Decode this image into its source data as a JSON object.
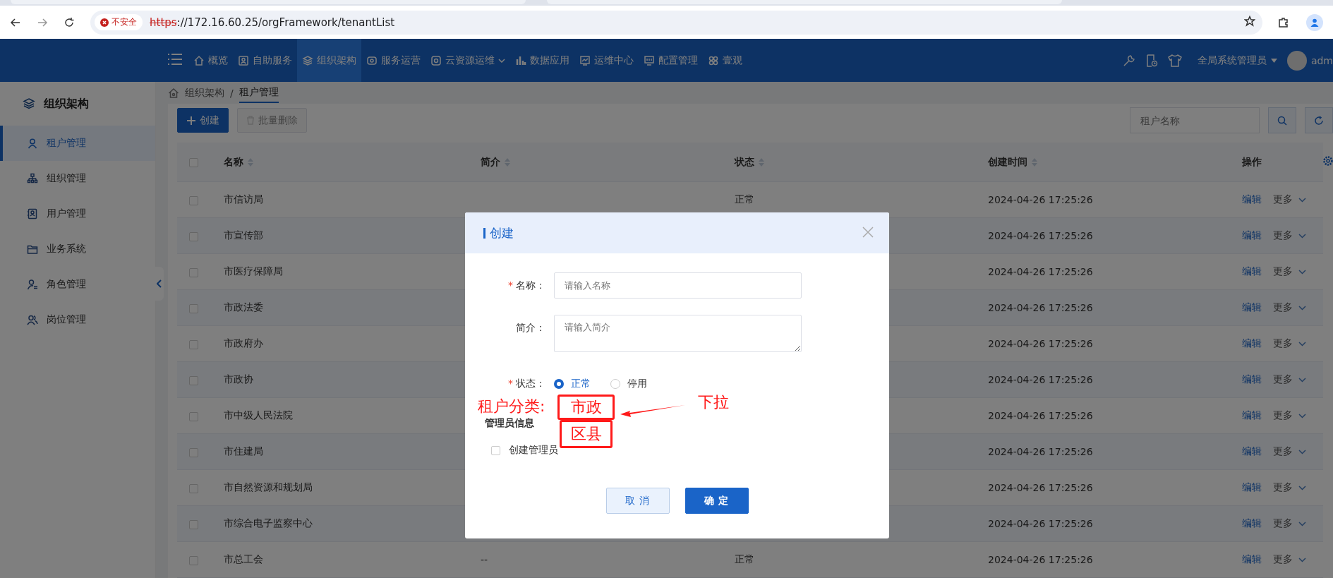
{
  "browser": {
    "security_label": "不安全",
    "url_scheme": "https",
    "url_rest": "://172.16.60.25/orgFramework/tenantList"
  },
  "nav": {
    "items": [
      {
        "label": "概览",
        "selected": false,
        "has_caret": false
      },
      {
        "label": "自助服务",
        "selected": false,
        "has_caret": false
      },
      {
        "label": "组织架构",
        "selected": true,
        "has_caret": false
      },
      {
        "label": "服务运营",
        "selected": false,
        "has_caret": false
      },
      {
        "label": "云资源运维",
        "selected": false,
        "has_caret": true
      },
      {
        "label": "数据应用",
        "selected": false,
        "has_caret": false
      },
      {
        "label": "运维中心",
        "selected": false,
        "has_caret": false
      },
      {
        "label": "配置管理",
        "selected": false,
        "has_caret": false
      },
      {
        "label": "壹观",
        "selected": false,
        "has_caret": false
      }
    ],
    "user": "全局系统管理员",
    "user_cut": "adm"
  },
  "sidebar": {
    "title": "组织架构",
    "items": [
      {
        "label": "租户管理",
        "selected": true
      },
      {
        "label": "组织管理",
        "selected": false
      },
      {
        "label": "用户管理",
        "selected": false
      },
      {
        "label": "业务系统",
        "selected": false
      },
      {
        "label": "角色管理",
        "selected": false
      },
      {
        "label": "岗位管理",
        "selected": false
      }
    ]
  },
  "breadcrumb": {
    "separator": "/",
    "items": [
      {
        "label": "组织架构",
        "current": false
      },
      {
        "label": "租户管理",
        "current": true
      }
    ]
  },
  "toolbar": {
    "create": "创建",
    "batch_delete": {
      "label": "批量删除",
      "disabled": true
    },
    "search_placeholder": "租户名称"
  },
  "table": {
    "header_checked": false,
    "columns": [
      {
        "label": "名称",
        "sortable": true
      },
      {
        "label": "简介",
        "sortable": true
      },
      {
        "label": "状态",
        "sortable": true
      },
      {
        "label": "创建时间",
        "sortable": true
      },
      {
        "label": "操作",
        "sortable": false
      }
    ],
    "rows": [
      {
        "checked": false,
        "name": "市信访局",
        "status": "正常",
        "created": "2024-04-26 17:25:26",
        "edit": "编辑",
        "more": "更多"
      },
      {
        "checked": false,
        "name": "市宣传部",
        "created": "2024-04-26 17:25:26",
        "edit": "编辑",
        "more": "更多"
      },
      {
        "checked": false,
        "name": "市医疗保障局",
        "created": "2024-04-26 17:25:26",
        "edit": "编辑",
        "more": "更多"
      },
      {
        "checked": false,
        "name": "市政法委",
        "created": "2024-04-26 17:25:26",
        "edit": "编辑",
        "more": "更多"
      },
      {
        "checked": false,
        "name": "市政府办",
        "created": "2024-04-26 17:25:26",
        "edit": "编辑",
        "more": "更多"
      },
      {
        "checked": false,
        "name": "市政协",
        "created": "2024-04-26 17:25:26",
        "edit": "编辑",
        "more": "更多"
      },
      {
        "checked": false,
        "name": "市中级人民法院",
        "created": "2024-04-26 17:25:26",
        "edit": "编辑",
        "more": "更多"
      },
      {
        "checked": false,
        "name": "市住建局",
        "created": "2024-04-26 17:25:26",
        "edit": "编辑",
        "more": "更多"
      },
      {
        "checked": false,
        "name": "市自然资源和规划局",
        "created": "2024-04-26 17:25:26",
        "edit": "编辑",
        "more": "更多"
      },
      {
        "checked": false,
        "name": "市综合电子监察中心",
        "created": "2024-04-26 17:25:26",
        "edit": "编辑",
        "more": "更多"
      },
      {
        "checked": false,
        "name": "市总工会",
        "intro": "--",
        "status": "正常",
        "created": "2024-04-26 17:25:26",
        "edit": "编辑",
        "more": "更多"
      }
    ]
  },
  "dialog": {
    "title": "创建",
    "required_mark": "*",
    "fields": [
      {
        "kind": "input",
        "label": "名称：",
        "required": true,
        "placeholder": "请输入名称"
      },
      {
        "kind": "textarea",
        "label": "简介：",
        "required": false,
        "placeholder": "请输入简介"
      },
      {
        "kind": "radio",
        "label": "状态：",
        "required": true,
        "options": [
          {
            "label": "正常",
            "selected": true
          },
          {
            "label": "停用",
            "selected": false
          }
        ]
      }
    ],
    "section": "管理员信息",
    "admin_checkbox": {
      "label": "创建管理员",
      "checked": false
    },
    "cancel": "取 消",
    "confirm": "确 定",
    "annotation": {
      "label": "租户分类:",
      "options": [
        "市政",
        "区县"
      ],
      "note": "下拉"
    }
  }
}
